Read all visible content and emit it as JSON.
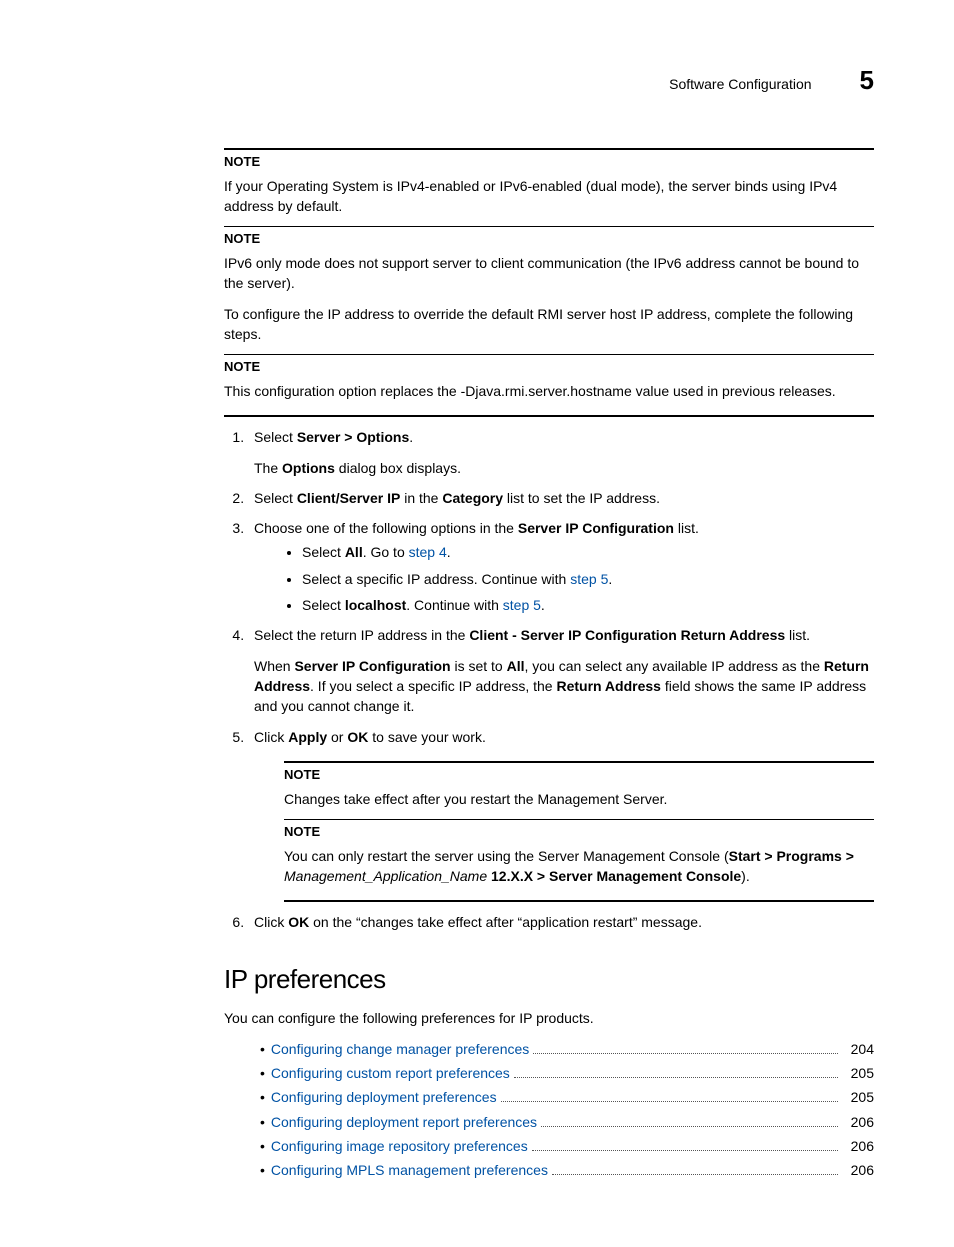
{
  "header": {
    "section": "Software Configuration",
    "chapter": "5"
  },
  "notes": {
    "label": "NOTE",
    "n1": "If your Operating System is IPv4-enabled or IPv6-enabled (dual mode), the server binds using IPv4 address by default.",
    "n2": "IPv6 only mode does not support server to client communication (the IPv6 address cannot be bound to the server).",
    "n3": "This configuration option replaces the -Djava.rmi.server.hostname value used in previous releases.",
    "n4": "Changes take effect after you restart the Management Server.",
    "n5_a": "You can only restart the server using the Server Management Console (",
    "n5_b": "Start > Programs > ",
    "n5_c": "Management_Application_Name",
    "n5_d": " 12.X.X > Server Management Console",
    "n5_e": ")."
  },
  "intro_para": "To configure the IP address to override the default RMI server host IP address, complete the following steps.",
  "steps": {
    "s1a": "Select ",
    "s1b": "Server > Options",
    "s1c": ".",
    "s1sub_a": "The ",
    "s1sub_b": "Options",
    "s1sub_c": " dialog box displays.",
    "s2a": "Select ",
    "s2b": "Client/Server IP",
    "s2c": " in the ",
    "s2d": "Category",
    "s2e": " list to set the IP address.",
    "s3a": "Choose one of the following options in the ",
    "s3b": "Server IP Configuration",
    "s3c": " list.",
    "s3_b1a": "Select ",
    "s3_b1b": "All",
    "s3_b1c": ". Go to ",
    "s3_b1d": "step 4",
    "s3_b1e": ".",
    "s3_b2a": "Select a specific IP address. Continue with ",
    "s3_b2b": "step 5",
    "s3_b2c": ".",
    "s3_b3a": "Select ",
    "s3_b3b": "localhost",
    "s3_b3c": ". Continue with ",
    "s3_b3d": "step 5",
    "s3_b3e": ".",
    "s4a": "Select the return IP address in the ",
    "s4b": "Client - Server IP Configuration Return Address",
    "s4c": " list.",
    "s4p_a": "When ",
    "s4p_b": "Server IP Configuration",
    "s4p_c": " is set to ",
    "s4p_d": "All",
    "s4p_e": ", you can select any available IP address as the ",
    "s4p_f": "Return Address",
    "s4p_g": ". If you select a specific IP address, the ",
    "s4p_h": "Return Address",
    "s4p_i": " field shows the same IP address and you cannot change it.",
    "s5a": "Click ",
    "s5b": "Apply",
    "s5c": " or ",
    "s5d": "OK",
    "s5e": " to save your work.",
    "s6a": "Click ",
    "s6b": "OK",
    "s6c": " on the “changes take effect after “application restart” message."
  },
  "section2": {
    "heading": "IP preferences",
    "intro": "You can configure the following preferences for IP products.",
    "toc": [
      {
        "label": "Configuring change manager preferences",
        "page": "204"
      },
      {
        "label": "Configuring custom report preferences",
        "page": "205"
      },
      {
        "label": "Configuring deployment preferences",
        "page": "205"
      },
      {
        "label": "Configuring deployment report preferences",
        "page": "206"
      },
      {
        "label": "Configuring image repository preferences",
        "page": "206"
      },
      {
        "label": "Configuring MPLS management preferences",
        "page": "206"
      }
    ]
  }
}
